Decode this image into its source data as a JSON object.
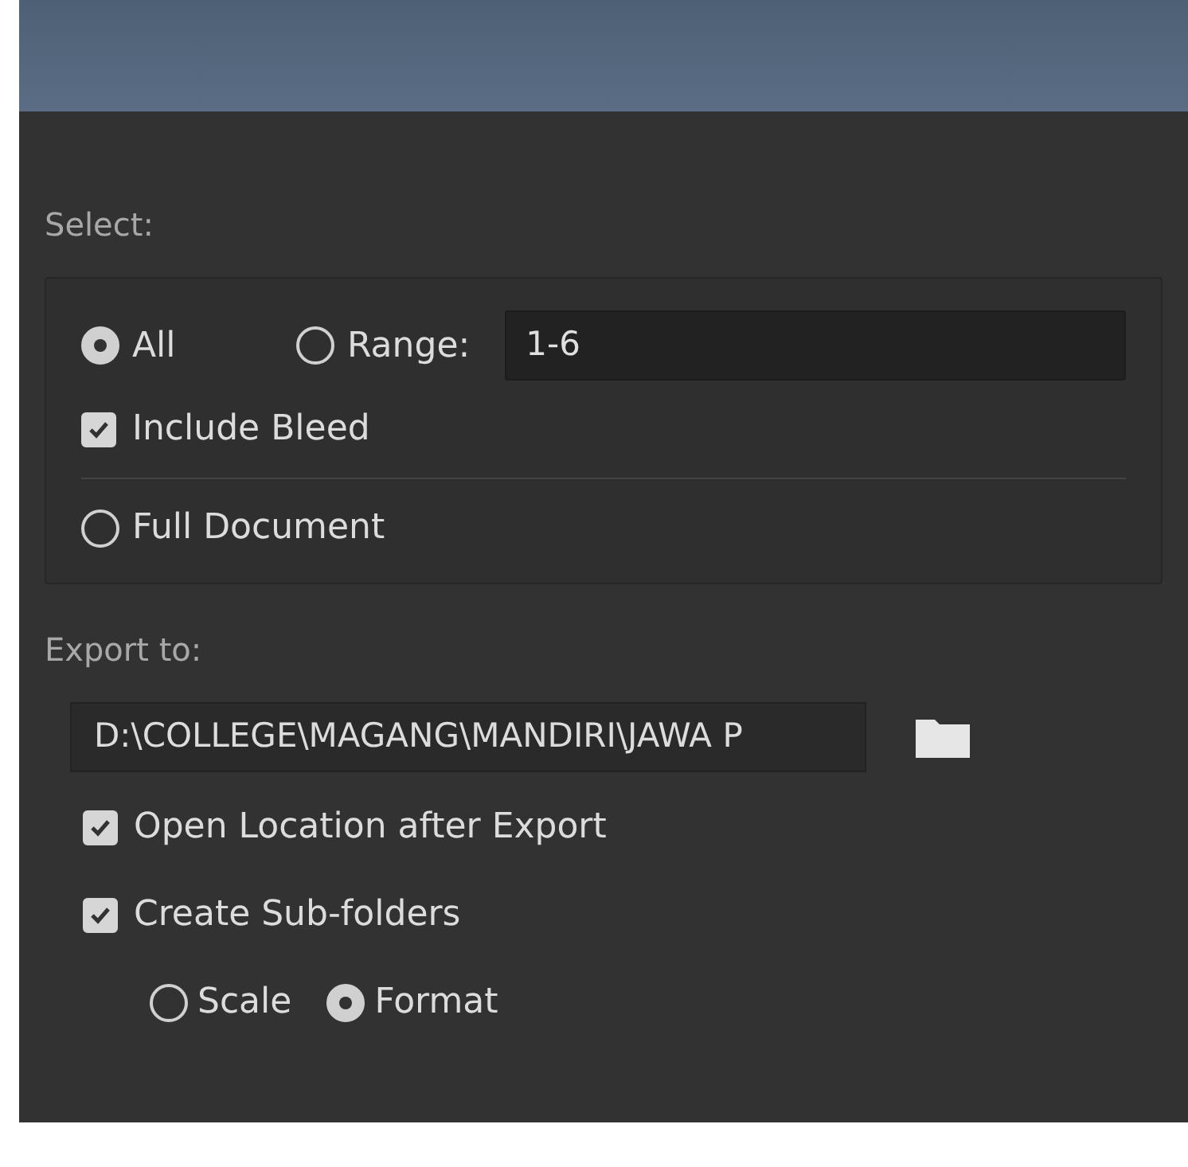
{
  "select": {
    "label": "Select:",
    "options": [
      {
        "kind": "radio",
        "label": "All",
        "selected": true
      },
      {
        "kind": "radio",
        "label": "Range:",
        "selected": false
      }
    ],
    "range": {
      "value": "1-6"
    },
    "include_bleed": {
      "label": "Include Bleed",
      "checked": true
    },
    "full_document": {
      "label": "Full Document",
      "selected": false
    }
  },
  "export_to": {
    "label": "Export to:",
    "path": "D:\\COLLEGE\\MAGANG\\MANDIRI\\JAWA P",
    "checks": [
      {
        "label": "Open Location after Export",
        "checked": true
      },
      {
        "label": "Create Sub-folders",
        "checked": true
      }
    ],
    "sub_options": [
      {
        "label": "Scale",
        "selected": false
      },
      {
        "label": "Format",
        "selected": true
      }
    ]
  }
}
